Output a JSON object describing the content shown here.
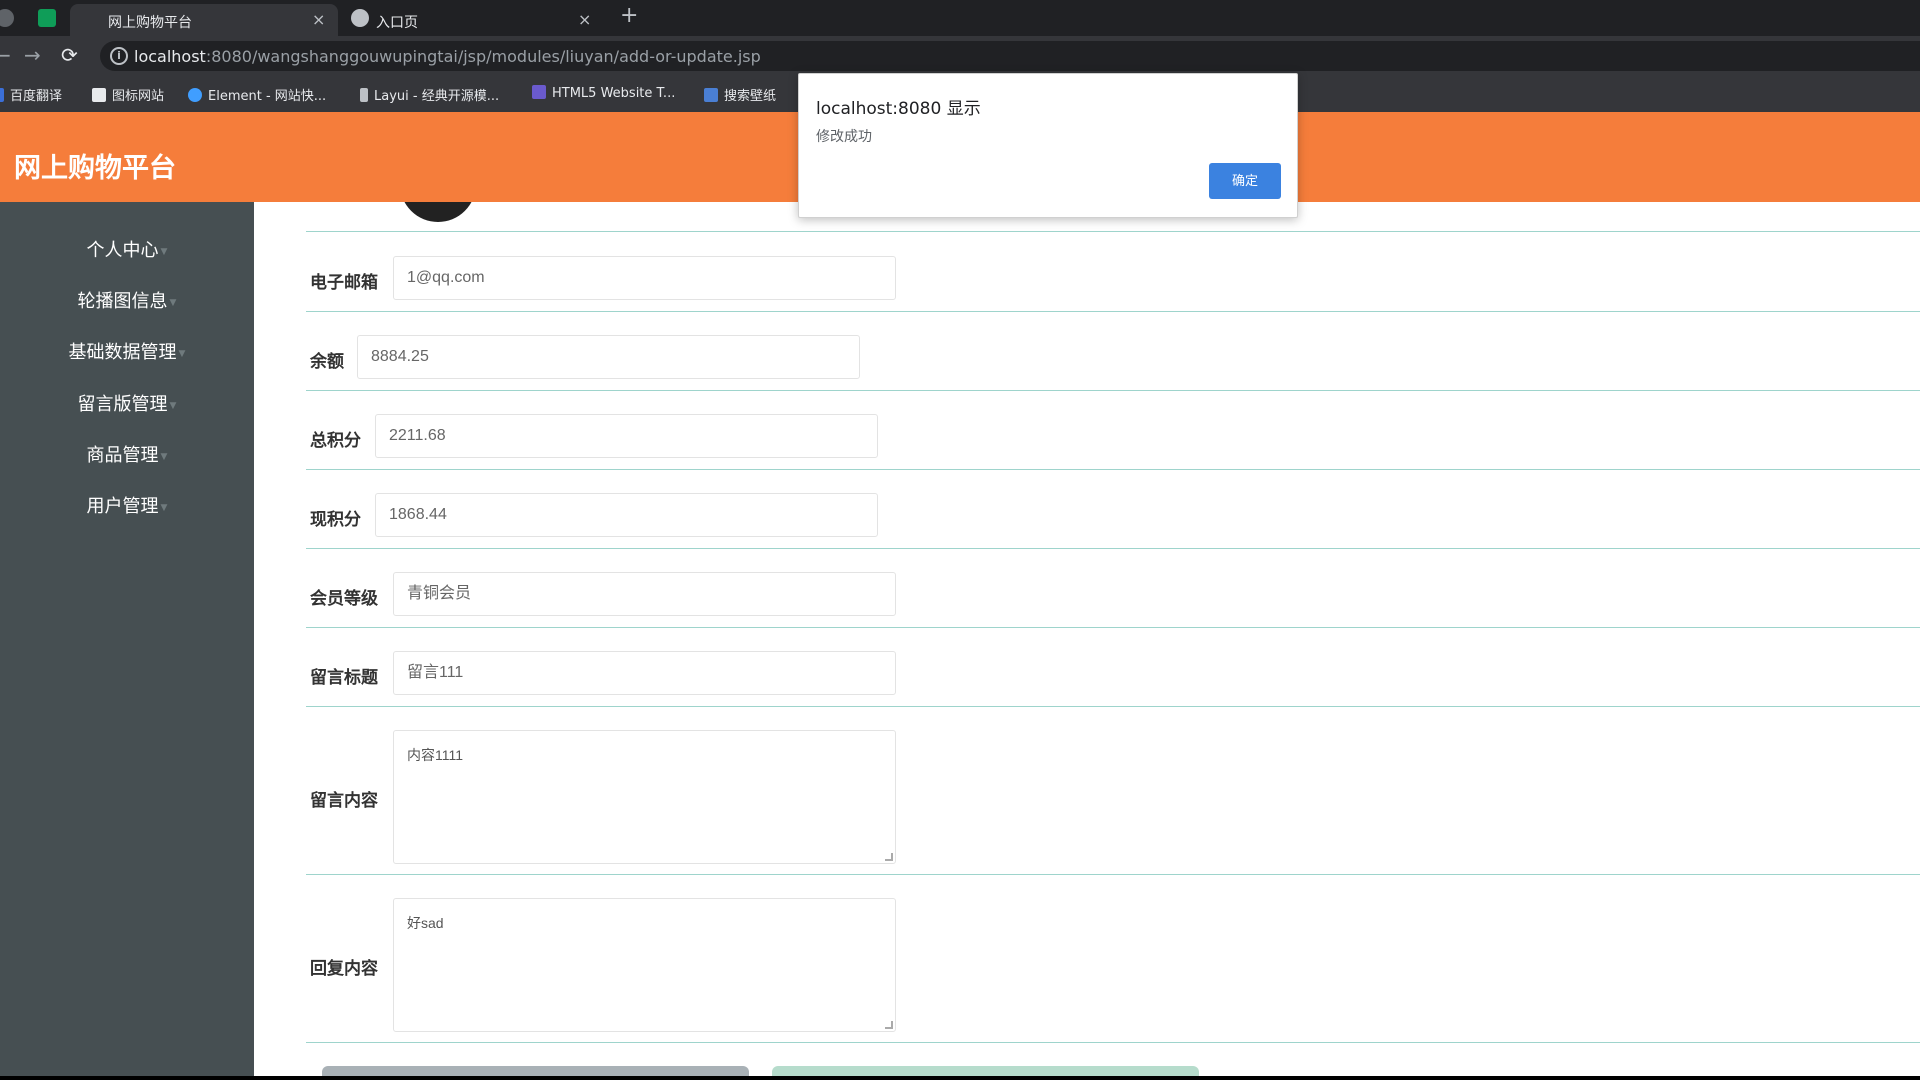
{
  "browser": {
    "tabs": [
      {
        "title": "网上购物平台",
        "close": "×",
        "active": true
      },
      {
        "title": "入口页",
        "close": "×",
        "active": false
      }
    ],
    "new_tab": "+",
    "nav": {
      "back": "←",
      "forward": "→",
      "reload": "⟳"
    },
    "url_host": "localhost",
    "url_rest": ":8080/wangshanggouwupingtai/jsp/modules/liuyan/add-or-update.jsp",
    "bookmarks": [
      {
        "label": "百度翻译",
        "color": "#3b6fd8"
      },
      {
        "label": "图标网站",
        "color": "#e8eaed"
      },
      {
        "label": "Element - 网站快...",
        "color": "#409eff"
      },
      {
        "label": "Layui - 经典开源模...",
        "color": "#bdc1c6"
      },
      {
        "label": "HTML5 Website T...",
        "color": "#6a5acd"
      },
      {
        "label": "搜索壁纸",
        "color": "#4a7fd4"
      }
    ]
  },
  "app": {
    "title": "网上购物平台",
    "accent": "#f57d3b",
    "sidebar_bg": "#464f52"
  },
  "sidebar": {
    "items": [
      {
        "label": "个人中心"
      },
      {
        "label": "轮播图信息"
      },
      {
        "label": "基础数据管理"
      },
      {
        "label": "留言版管理"
      },
      {
        "label": "商品管理"
      },
      {
        "label": "用户管理"
      }
    ]
  },
  "form": {
    "email": {
      "label": "电子邮箱",
      "value": "1@qq.com"
    },
    "balance": {
      "label": "余额",
      "value": "8884.25"
    },
    "total_points": {
      "label": "总积分",
      "value": "2211.68"
    },
    "current_points": {
      "label": "现积分",
      "value": "1868.44"
    },
    "member_level": {
      "label": "会员等级",
      "value": "青铜会员"
    },
    "message_title": {
      "label": "留言标题",
      "value": "留言111"
    },
    "message_content": {
      "label": "留言内容",
      "value": "内容1111"
    },
    "reply_content": {
      "label": "回复内容",
      "value": "好sad"
    }
  },
  "dialog": {
    "title": "localhost:8080 显示",
    "message": "修改成功",
    "ok_label": "确定"
  }
}
